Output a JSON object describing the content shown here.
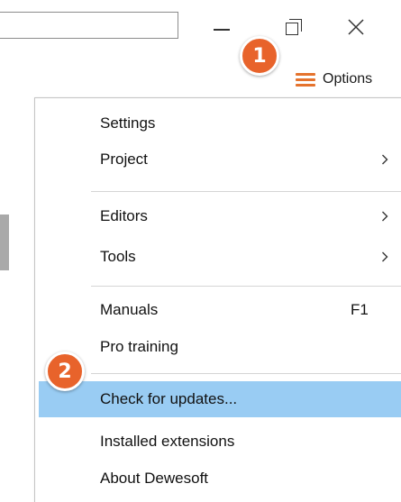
{
  "titlebar": {
    "search_value": "",
    "minimize_icon": "minimize-icon",
    "restore_icon": "restore-icon",
    "close_icon": "close-icon"
  },
  "options": {
    "label": "Options",
    "icon": "hamburger-menu-icon",
    "accent_color": "#e5732d"
  },
  "menu": {
    "items": [
      {
        "label": "Settings",
        "shortcut": "",
        "submenu": false
      },
      {
        "label": "Project",
        "shortcut": "",
        "submenu": true
      },
      {
        "label": "Editors",
        "shortcut": "",
        "submenu": true
      },
      {
        "label": "Tools",
        "shortcut": "",
        "submenu": true
      },
      {
        "label": "Manuals",
        "shortcut": "F1",
        "submenu": false
      },
      {
        "label": "Pro training",
        "shortcut": "",
        "submenu": false
      },
      {
        "label": "Check for updates...",
        "shortcut": "",
        "submenu": false,
        "highlighted": true
      },
      {
        "label": "Installed extensions",
        "shortcut": "",
        "submenu": false
      },
      {
        "label": "About Dewesoft",
        "shortcut": "",
        "submenu": false
      }
    ],
    "highlight_color": "#99ccf3"
  },
  "callouts": [
    {
      "number": "1",
      "color": "#e8632b"
    },
    {
      "number": "2",
      "color": "#e8632b"
    }
  ]
}
